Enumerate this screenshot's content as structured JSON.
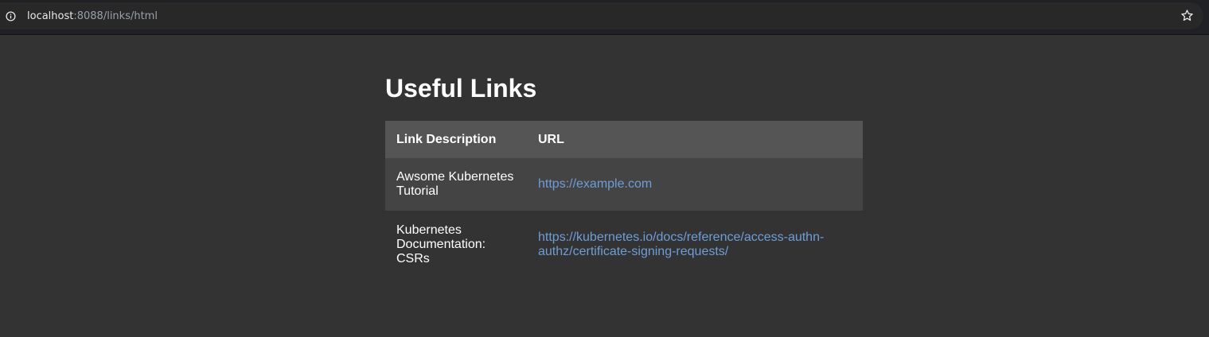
{
  "browser": {
    "url_host": "localhost",
    "url_rest": ":8088/links/html",
    "info_icon": "info-circle-icon",
    "bookmark_icon": "star-outline-icon"
  },
  "page": {
    "title": "Useful Links",
    "table": {
      "headers": [
        "Link Description",
        "URL"
      ],
      "rows": [
        {
          "description": "Awsome Kubernetes Tutorial",
          "url": "https://example.com"
        },
        {
          "description": "Kubernetes Documentation: CSRs",
          "url": "https://kubernetes.io/docs/reference/access-authn-authz/certificate-signing-requests/"
        }
      ]
    }
  },
  "colors": {
    "page_background": "#333333",
    "header_background": "#555555",
    "alt_row_background": "#444444",
    "link": "#6f9dd6"
  }
}
